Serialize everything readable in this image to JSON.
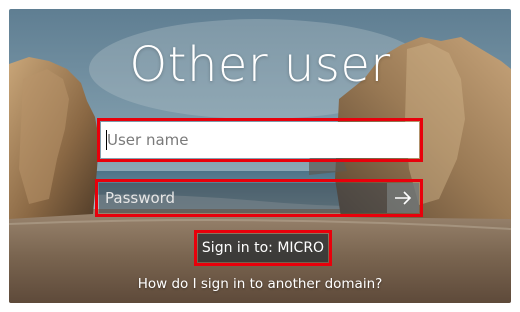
{
  "title": "Other user",
  "username": {
    "placeholder": "User name",
    "value": ""
  },
  "password": {
    "placeholder": "Password",
    "value": "",
    "submit_icon": "arrow-right-icon"
  },
  "signin_to": "Sign in to: MICRO",
  "help_link": "How do I sign in to another domain?",
  "colors": {
    "highlight": "#e8000b",
    "text": "#ffffff",
    "input_bg": "#ffffff"
  }
}
